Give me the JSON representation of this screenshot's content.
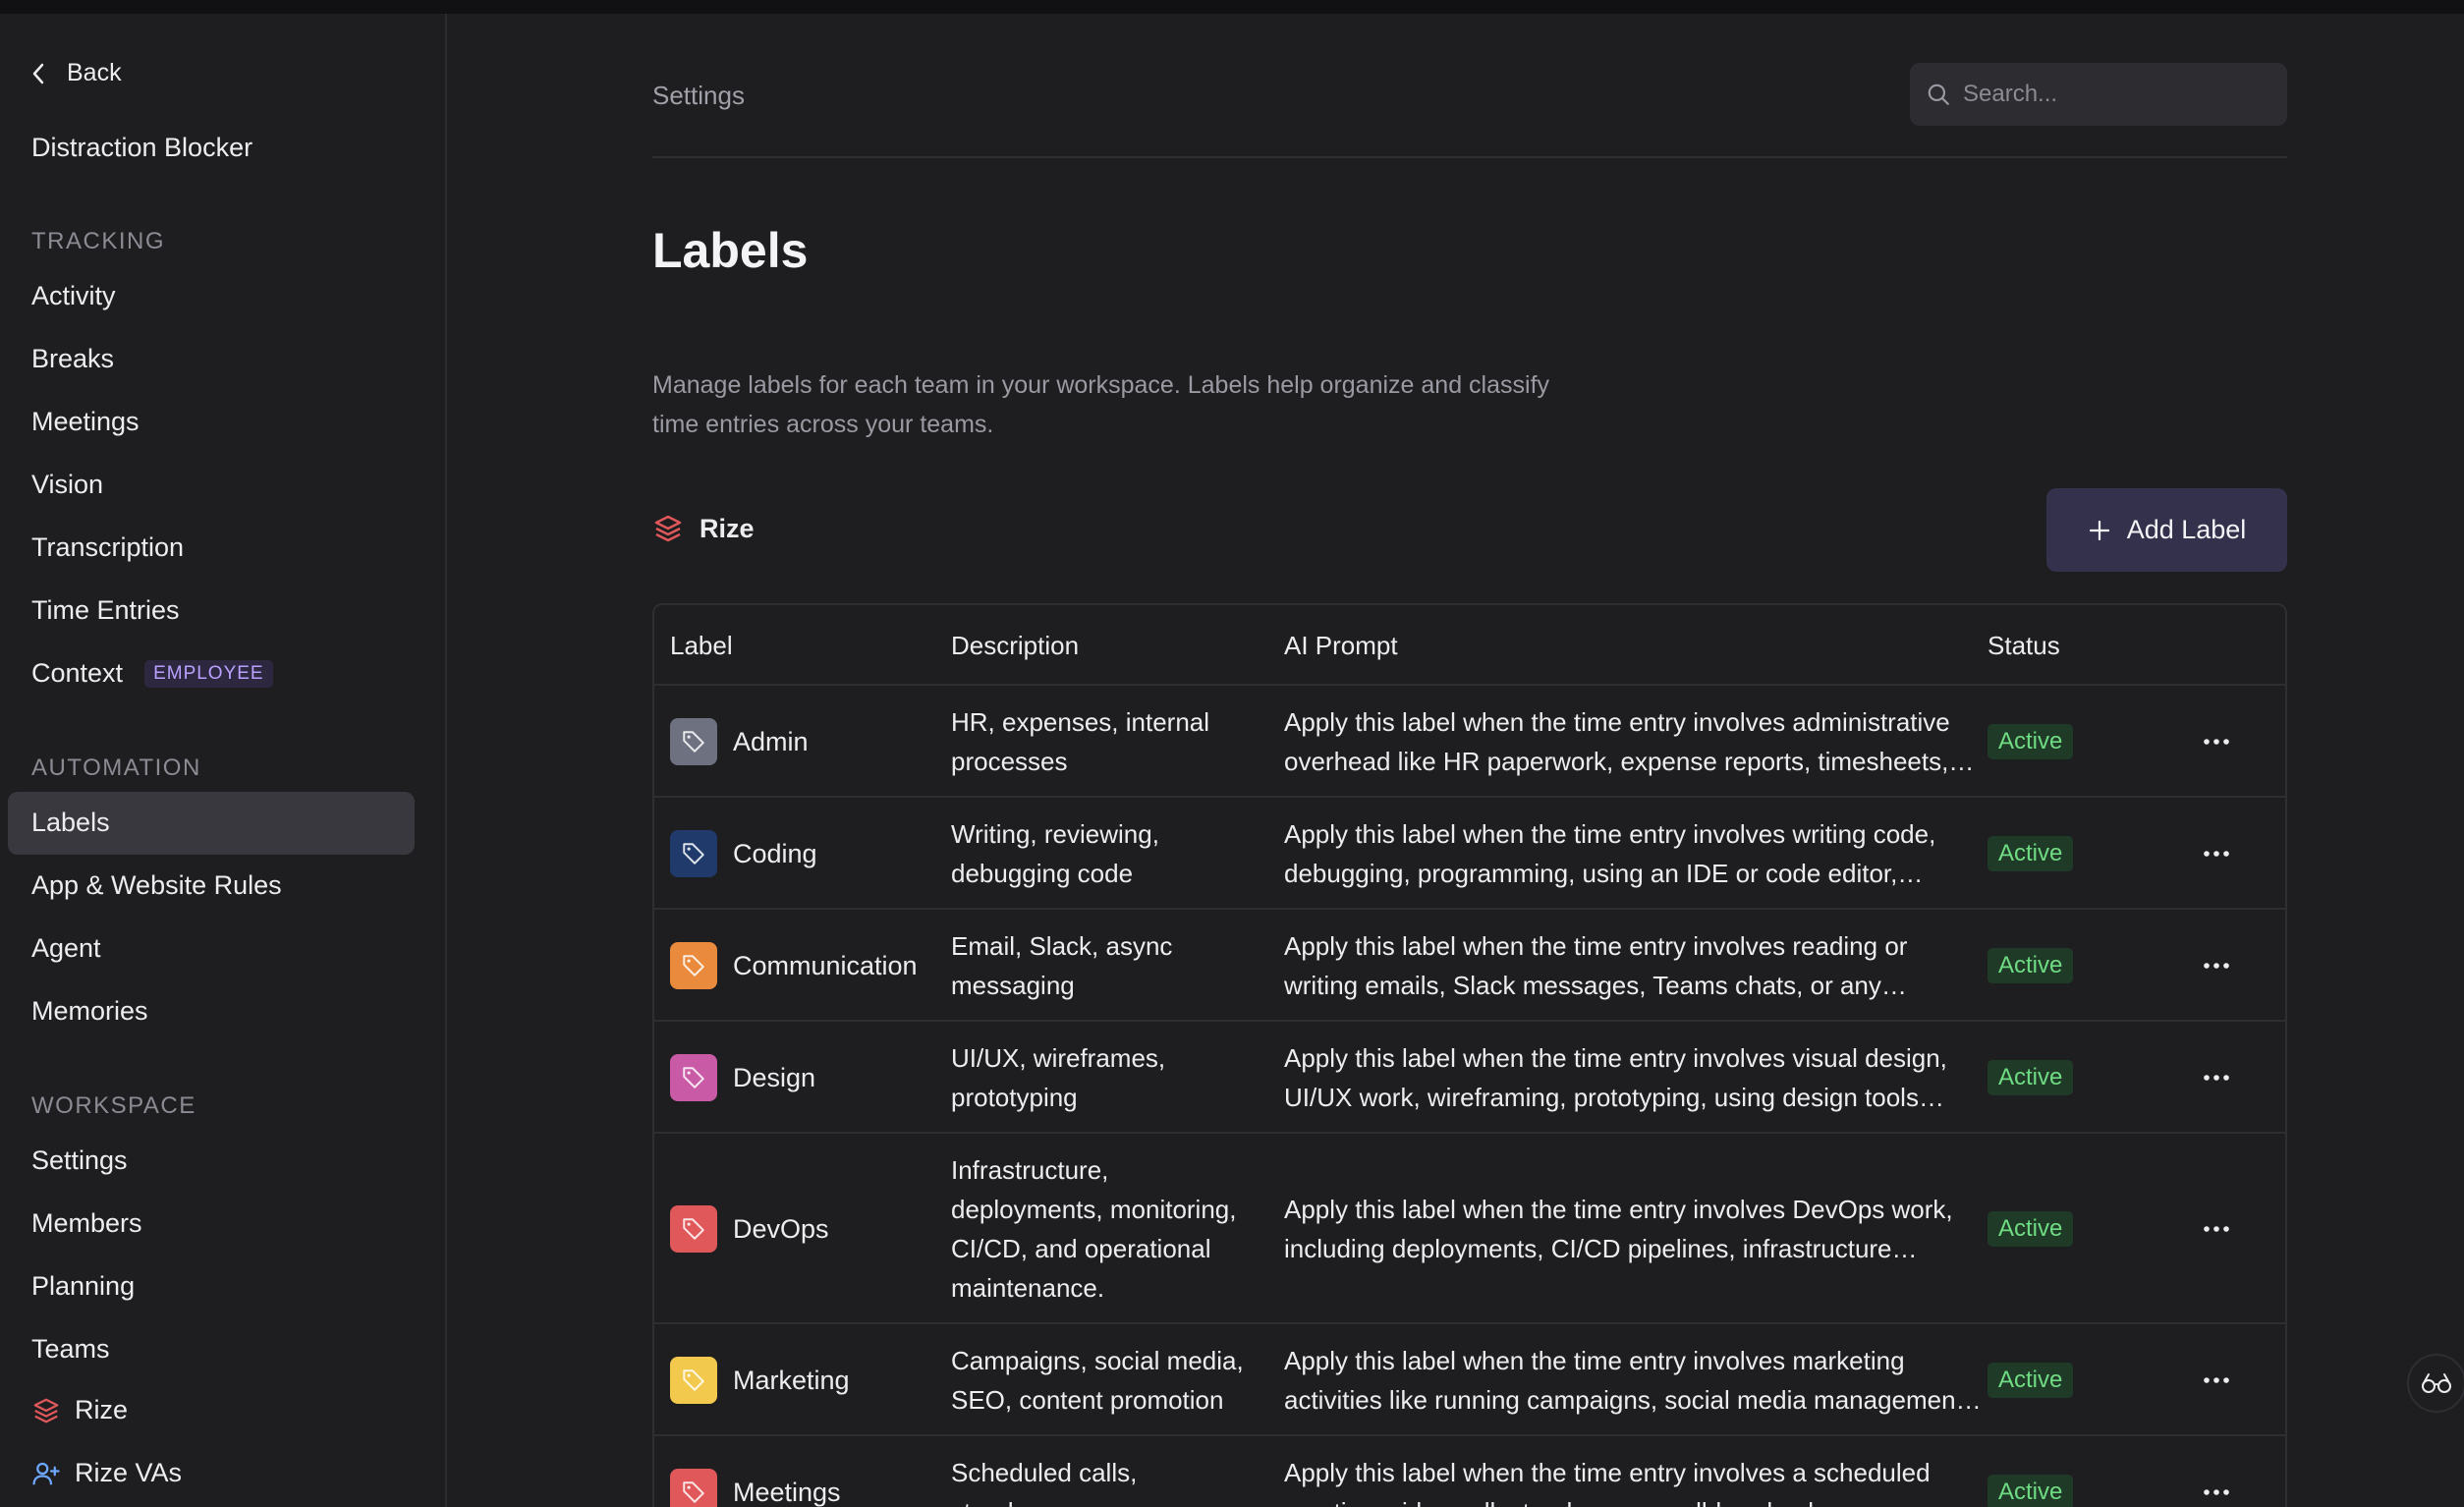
{
  "sidebar": {
    "back_label": "Back",
    "top_item": "Distraction Blocker",
    "sections": {
      "tracking": "TRACKING",
      "automation": "AUTOMATION",
      "workspace": "WORKSPACE"
    },
    "tracking_items": [
      "Activity",
      "Breaks",
      "Meetings",
      "Vision",
      "Transcription",
      "Time Entries",
      "Context"
    ],
    "context_badge": "EMPLOYEE",
    "automation_items": [
      "Labels",
      "App & Website Rules",
      "Agent",
      "Memories"
    ],
    "workspace_items": [
      "Settings",
      "Members",
      "Planning",
      "Teams",
      "Rize",
      "Rize VAs"
    ],
    "active_item": "Labels"
  },
  "header": {
    "breadcrumb": "Settings",
    "search_placeholder": "Search..."
  },
  "main": {
    "title": "Labels",
    "description": "Manage labels for each team in your workspace. Labels help organize and classify time entries across your teams.",
    "team_name": "Rize",
    "add_button": "Add Label"
  },
  "table": {
    "columns": [
      "Label",
      "Description",
      "AI Prompt",
      "Status"
    ],
    "rows": [
      {
        "label": "Admin",
        "color": "#6e7180",
        "description": "HR, expenses, internal processes",
        "prompt_line1": "Apply this label when the time entry involves administrative",
        "prompt_line2": "overhead like HR paperwork, expense reports, timesheets,…",
        "status": "Active"
      },
      {
        "label": "Coding",
        "color": "#1f3a6b",
        "description": "Writing, reviewing, debugging code",
        "prompt_line1": "Apply this label when the time entry involves writing code,",
        "prompt_line2": "debugging, programming, using an IDE or code editor,…",
        "status": "Active"
      },
      {
        "label": "Communication",
        "color": "#ea8a3c",
        "description": "Email, Slack, async messaging",
        "prompt_line1": "Apply this label when the time entry involves reading or",
        "prompt_line2": "writing emails, Slack messages, Teams chats, or any…",
        "status": "Active"
      },
      {
        "label": "Design",
        "color": "#c95aa6",
        "description": "UI/UX, wireframes, prototyping",
        "prompt_line1": "Apply this label when the time entry involves visual design,",
        "prompt_line2": "UI/UX work, wireframing, prototyping, using design tools…",
        "status": "Active"
      },
      {
        "label": "DevOps",
        "color": "#e0585a",
        "description": "Infrastructure, deployments, monitoring, CI/CD, and operational maintenance.",
        "prompt_line1": "Apply this label when the time entry involves DevOps work,",
        "prompt_line2": "including deployments, CI/CD pipelines, infrastructure…",
        "status": "Active"
      },
      {
        "label": "Marketing",
        "color": "#f2c94c",
        "description": "Campaigns, social media, SEO, content promotion",
        "prompt_line1": "Apply this label when the time entry involves marketing",
        "prompt_line2": "activities like running campaigns, social media managemen…",
        "status": "Active"
      },
      {
        "label": "Meetings",
        "color": "#e0585a",
        "description": "Scheduled calls, standups, syncs",
        "prompt_line1": "Apply this label when the time entry involves a scheduled",
        "prompt_line2": "meeting, video call, standup, sync, all-hands, demo…",
        "status": "Active"
      }
    ]
  }
}
